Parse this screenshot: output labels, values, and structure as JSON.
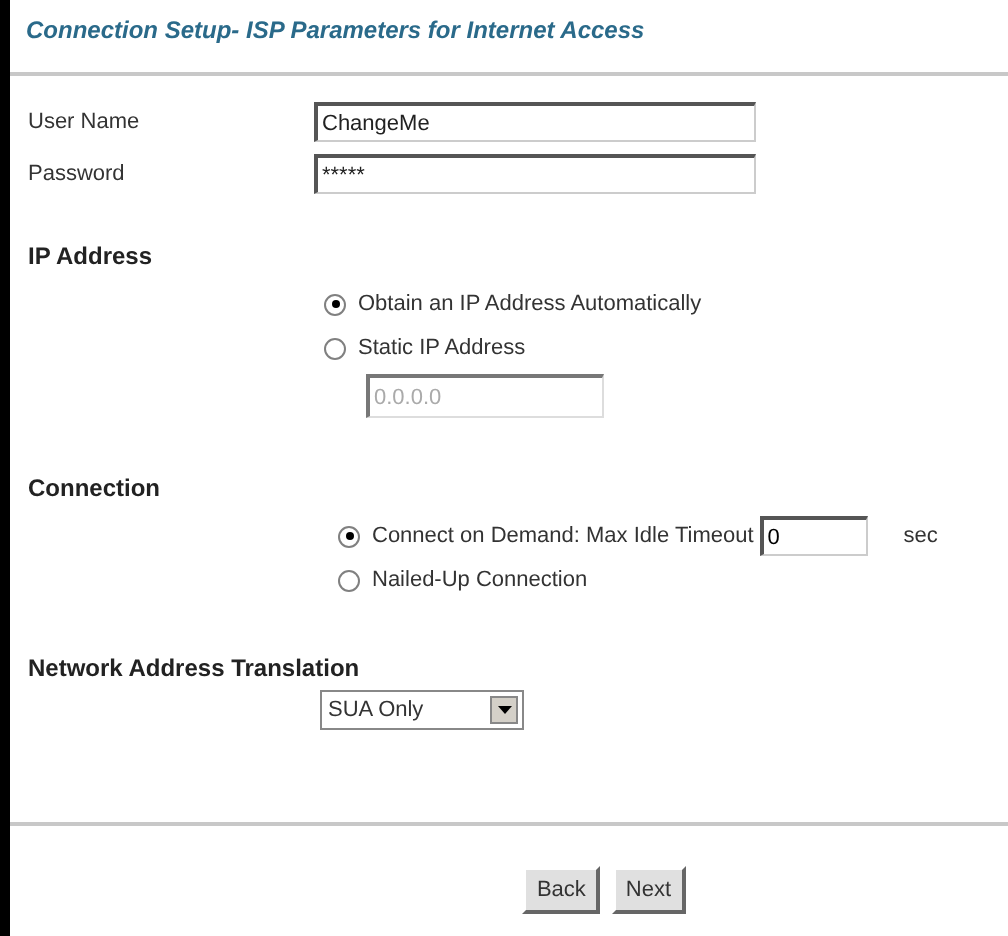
{
  "title": "Connection Setup- ISP Parameters for Internet Access",
  "fields": [
    {
      "label": "User Name",
      "value": "ChangeMe"
    },
    {
      "label": "Password",
      "value": "*****"
    }
  ],
  "ip_address": {
    "heading": "IP Address",
    "options": [
      {
        "label": "Obtain an IP Address Automatically",
        "selected": true
      },
      {
        "label": "Static IP Address",
        "selected": false
      }
    ],
    "static_ip": {
      "value": "0.0.0.0",
      "disabled": true
    }
  },
  "connection": {
    "heading": "Connection",
    "options": [
      {
        "label": "Connect on Demand: Max Idle Timeout",
        "selected": true,
        "kind": "timeout",
        "timeout": "0",
        "unit": "sec"
      },
      {
        "label": "Nailed-Up Connection",
        "selected": false,
        "kind": "plain"
      }
    ]
  },
  "nat": {
    "heading": "Network Address Translation",
    "value": "SUA Only"
  },
  "buttons": [
    "Back",
    "Next"
  ]
}
